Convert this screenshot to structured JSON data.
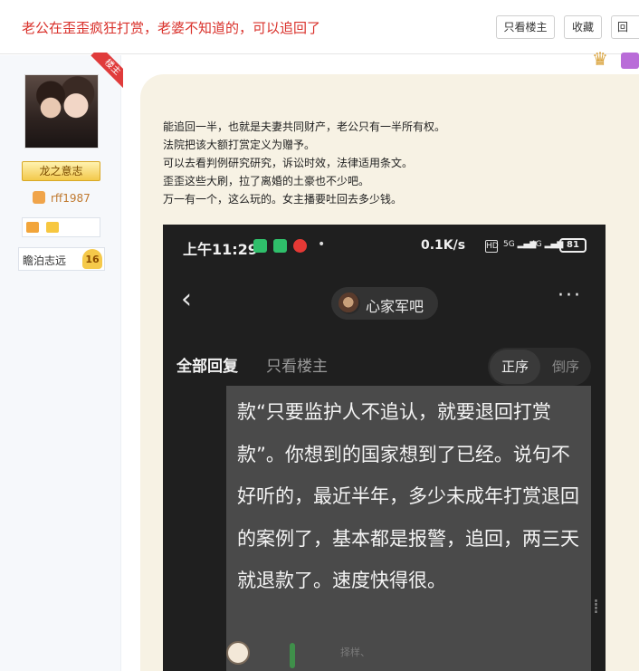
{
  "header": {
    "thread_title": "老公在歪歪疯狂打赏，老婆不知道的，可以追回了",
    "only_owner_button": "只看楼主",
    "favorite_button": "收藏",
    "reply_button": "回"
  },
  "sidebar": {
    "owner_badge": "楼主",
    "level_tag": "龙之意志",
    "username": "rff1987",
    "rank_title": "瞻泊志远",
    "rank_level": "16"
  },
  "post": {
    "lines": [
      "能追回一半，也就是夫妻共同财产，老公只有一半所有权。",
      "法院把该大额打赏定义为赠予。",
      "可以去看判例研究研究，诉讼时效，法律适用条文。",
      "歪歪这些大刷，拉了离婚的土豪也不少吧。",
      "万一有一个，这么玩的。女主播要吐回去多少钱。"
    ]
  },
  "phone": {
    "time": "上午11:29",
    "network_speed": "0.1K/s",
    "hd_label": "HD",
    "signal_1": "5G",
    "signal_2": "4G",
    "battery": "81",
    "forum_name": "心家军吧",
    "tab_all": "全部回复",
    "tab_owner": "只看楼主",
    "order_asc": "正序",
    "order_desc": "倒序",
    "reply_text": "款“只要监护人不追认，就要退回打赏款”。你想到的国家想到了已经。说句不好听的，最近半年，多少未成年打赏退回的案例了，基本都是报警，追回，两三天就退款了。速度快得很。",
    "sticker_text": "择样、"
  },
  "colors": {
    "title_red": "#d9302a",
    "bubble_bg": "#f7f2e4",
    "phone_bg": "#1f1f1f",
    "reply_card_bg": "#4a4a4a"
  }
}
